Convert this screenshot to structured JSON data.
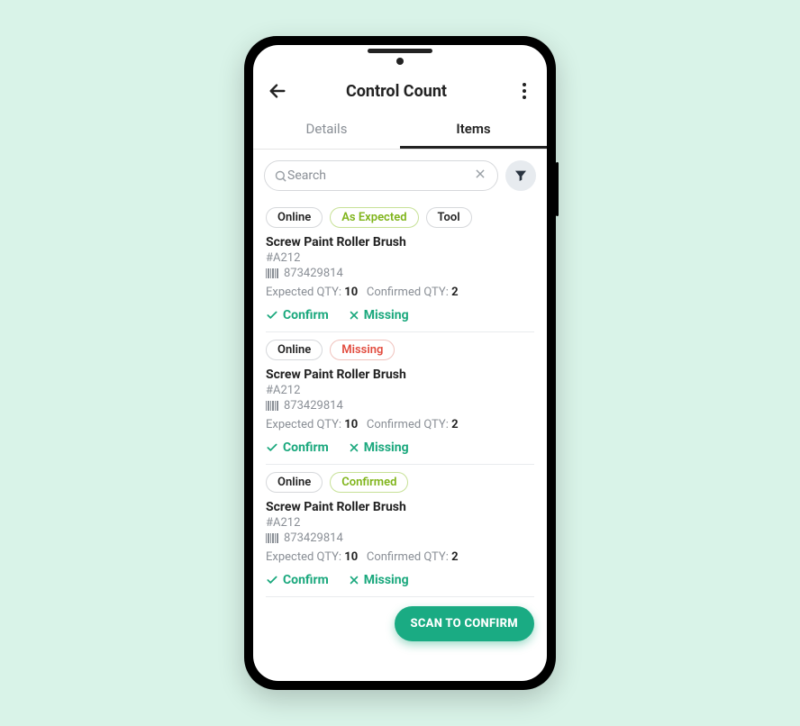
{
  "header": {
    "title": "Control Count"
  },
  "tabs": [
    {
      "label": "Details",
      "active": false
    },
    {
      "label": "Items",
      "active": true
    }
  ],
  "search": {
    "placeholder": "Search"
  },
  "items": [
    {
      "chips": [
        {
          "label": "Online",
          "style": ""
        },
        {
          "label": "As Expected",
          "style": "green"
        },
        {
          "label": "Tool",
          "style": ""
        }
      ],
      "name": "Screw Paint Roller Brush",
      "code": "#A212",
      "barcode": "873429814",
      "expectedLabel": "Expected QTY:",
      "expectedValue": "10",
      "confirmedLabel": "Confirmed QTY:",
      "confirmedValue": "2",
      "confirmLabel": "Confirm",
      "missingLabel": "Missing"
    },
    {
      "chips": [
        {
          "label": "Online",
          "style": ""
        },
        {
          "label": "Missing",
          "style": "red"
        }
      ],
      "name": "Screw Paint Roller Brush",
      "code": "#A212",
      "barcode": "873429814",
      "expectedLabel": "Expected QTY:",
      "expectedValue": "10",
      "confirmedLabel": "Confirmed QTY:",
      "confirmedValue": "2",
      "confirmLabel": "Confirm",
      "missingLabel": "Missing"
    },
    {
      "chips": [
        {
          "label": "Online",
          "style": ""
        },
        {
          "label": "Confirmed",
          "style": "green"
        }
      ],
      "name": "Screw Paint Roller Brush",
      "code": "#A212",
      "barcode": "873429814",
      "expectedLabel": "Expected QTY:",
      "expectedValue": "10",
      "confirmedLabel": "Confirmed QTY:",
      "confirmedValue": "2",
      "confirmLabel": "Confirm",
      "missingLabel": "Missing"
    }
  ],
  "fab": {
    "label": "SCAN TO CONFIRM"
  }
}
